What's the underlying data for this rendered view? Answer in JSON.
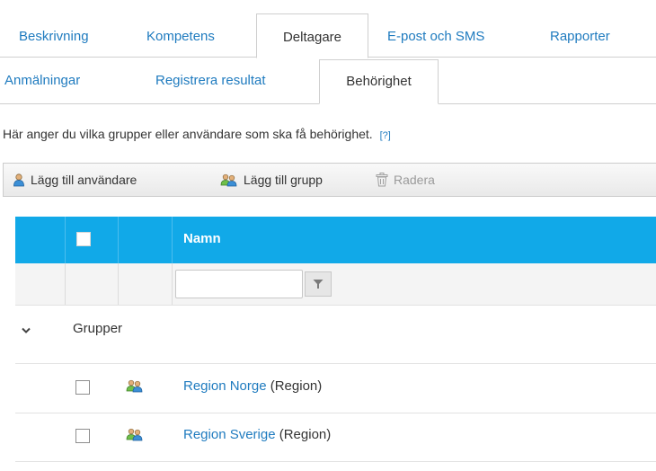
{
  "tabs_primary": [
    {
      "label": "Beskrivning",
      "active": false
    },
    {
      "label": "Kompetens",
      "active": false
    },
    {
      "label": "Deltagare",
      "active": true
    },
    {
      "label": "E-post och SMS",
      "active": false
    },
    {
      "label": "Rapporter",
      "active": false
    }
  ],
  "tabs_secondary": [
    {
      "label": "Anmälningar",
      "active": false
    },
    {
      "label": "Registrera resultat",
      "active": false
    },
    {
      "label": "Behörighet",
      "active": true
    }
  ],
  "info": {
    "text": "Här anger du vilka grupper eller användare som ska få behörighet.",
    "help_link": "[?]"
  },
  "toolbar": {
    "add_user": "Lägg till användare",
    "add_group": "Lägg till grupp",
    "delete": "Radera"
  },
  "grid": {
    "column_name": "Namn",
    "filter_value": "",
    "group_label": "Grupper",
    "rows": [
      {
        "name": "Region Norge",
        "type": "(Region)"
      },
      {
        "name": "Region Sverige",
        "type": "(Region)"
      }
    ]
  },
  "colors": {
    "accent": "#11a9e8",
    "link": "#1f7bbf"
  },
  "icons": {
    "add_user": "user-icon",
    "add_group": "group-icon",
    "delete": "trash-icon",
    "filter": "filter-icon",
    "group_toggle": "chevron-down-icon",
    "row_icon": "group-icon"
  }
}
